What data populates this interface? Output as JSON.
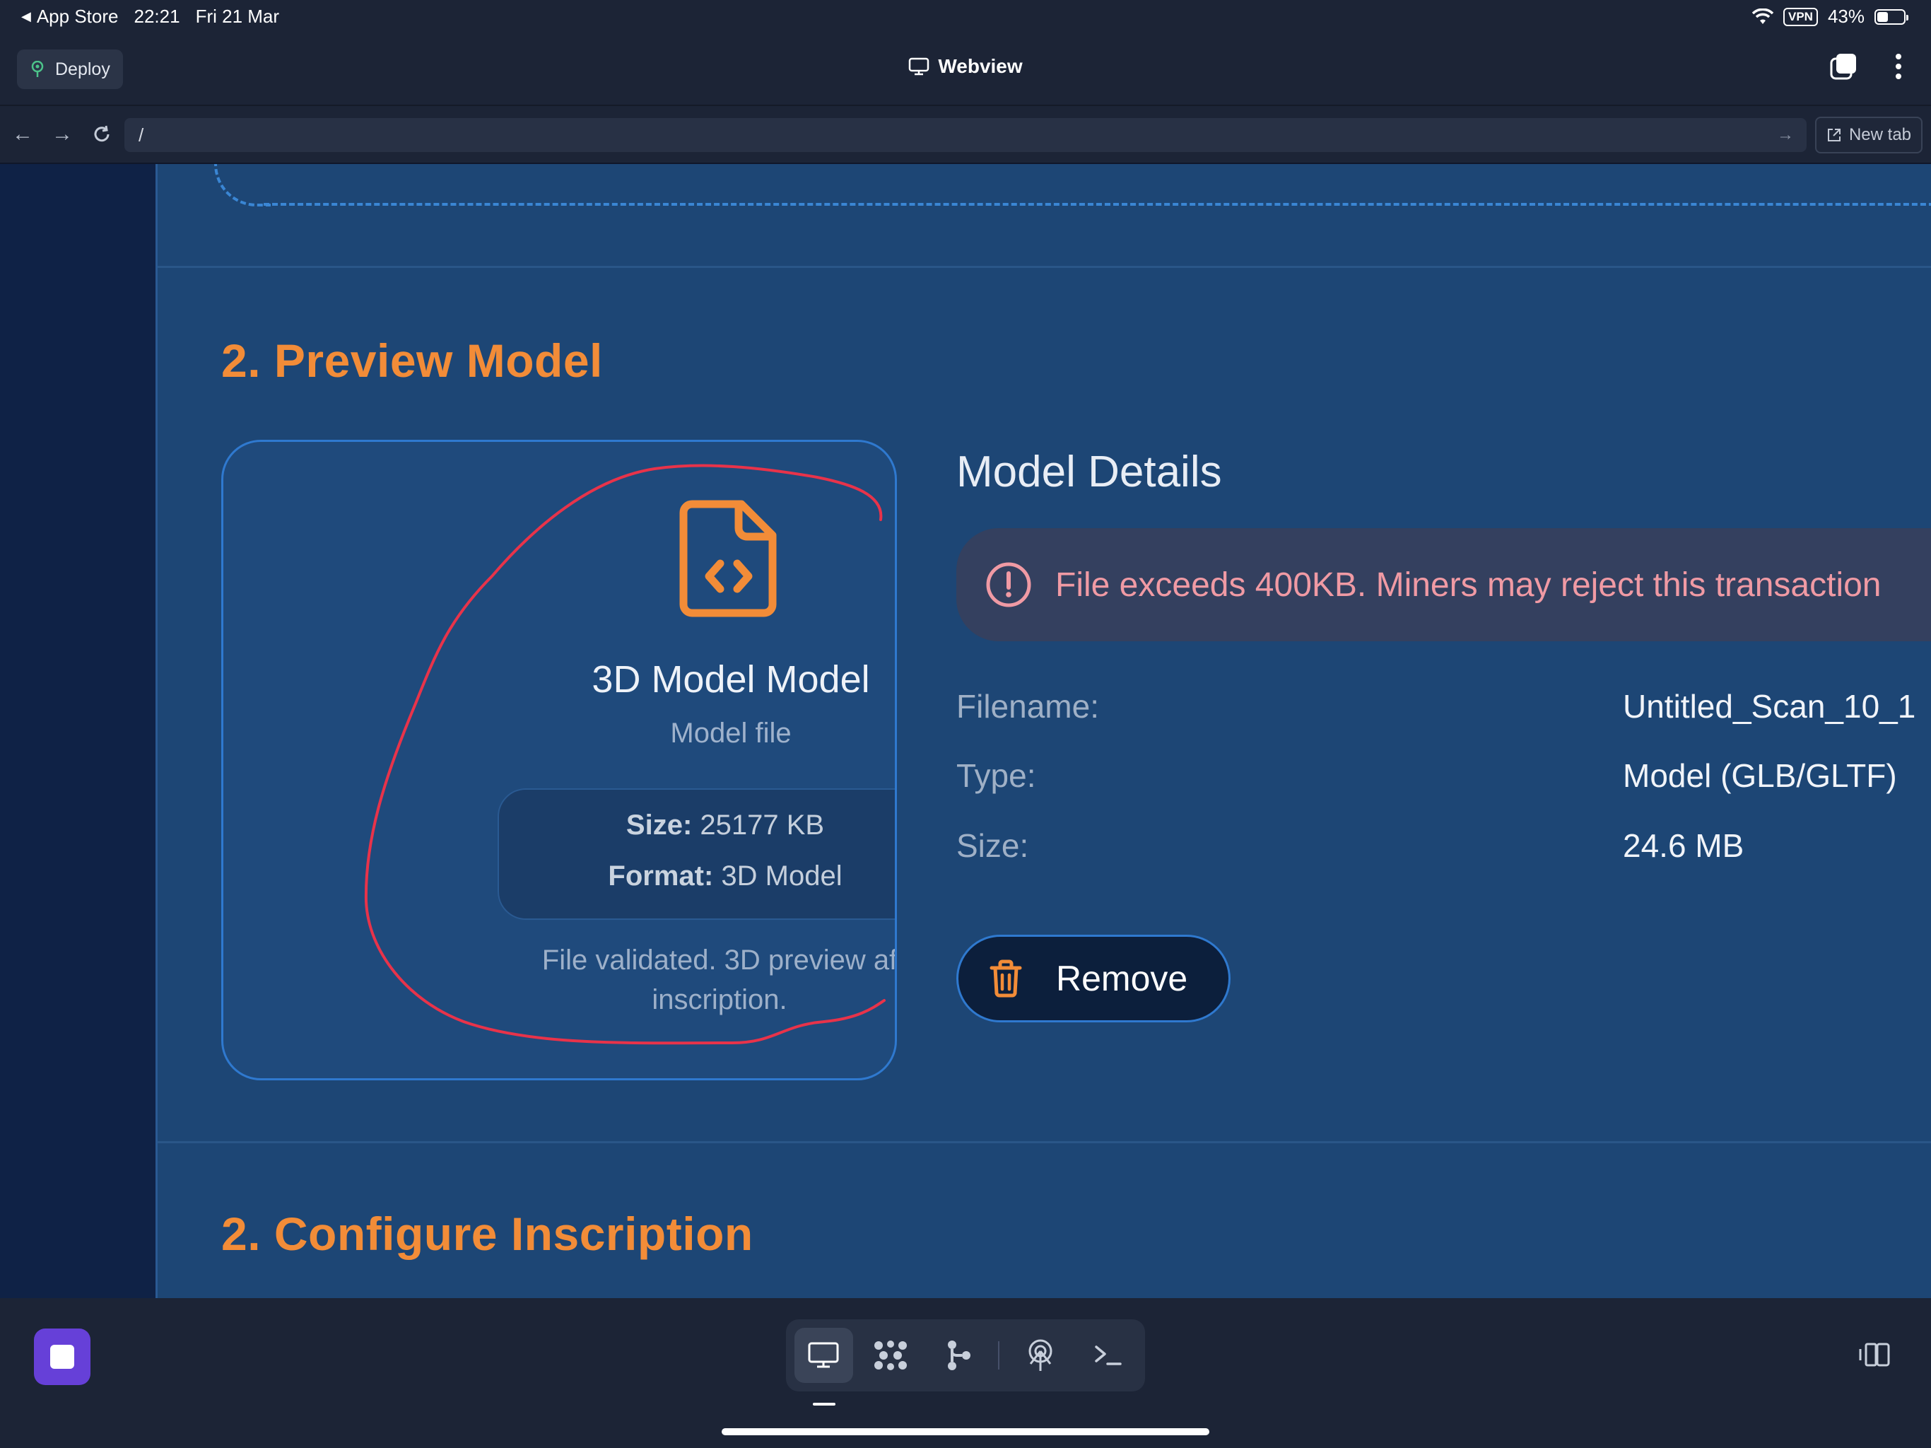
{
  "status_bar": {
    "back_app": "App Store",
    "time": "22:21",
    "date": "Fri 21 Mar",
    "vpn": "VPN",
    "battery": "43%",
    "battery_level": 0.43
  },
  "app_bar": {
    "deploy_label": "Deploy",
    "title": "Webview"
  },
  "url_bar": {
    "url": "/",
    "new_tab_label": "New tab"
  },
  "preview_section": {
    "title": "2. Preview Model",
    "card": {
      "title": "3D Model Model",
      "subtitle": "Model file",
      "size_label": "Size:",
      "size_value": "25177 KB",
      "format_label": "Format:",
      "format_value": "3D Model",
      "note_line1": "File validated. 3D preview af",
      "note_line2": "inscription."
    }
  },
  "details": {
    "title": "Model Details",
    "warning": "File exceeds 400KB. Miners may reject this transaction",
    "rows": [
      {
        "label": "Filename:",
        "value": "Untitled_Scan_10_1"
      },
      {
        "label": "Type:",
        "value": "Model (GLB/GLTF)"
      },
      {
        "label": "Size:",
        "value": "24.6 MB"
      }
    ],
    "remove_label": "Remove"
  },
  "configure_section": {
    "title": "2. Configure Inscription"
  },
  "colors": {
    "accent_orange": "#f28c38",
    "warning_pink": "#f09aa4",
    "content_bg": "#1d4675",
    "annotation_red": "#e8334a",
    "stop_purple": "#6640d8"
  },
  "icons": {
    "back": "chevron-left-icon",
    "deploy": "deploy-icon",
    "webview": "monitor-icon",
    "tabs": "tabs-icon",
    "more": "more-vertical-icon",
    "nav_back": "arrow-left-icon",
    "nav_forward": "arrow-right-icon",
    "reload": "reload-icon",
    "go": "arrow-right-icon",
    "new_tab": "external-link-icon",
    "file": "file-code-icon",
    "alert": "alert-circle-icon",
    "trash": "trash-icon",
    "stop": "stop-icon",
    "dock_tools": [
      "monitor-icon",
      "dots-grid-icon",
      "git-branch-icon",
      "antenna-icon",
      "terminal-icon"
    ],
    "side_panel": "side-panel-icon"
  }
}
